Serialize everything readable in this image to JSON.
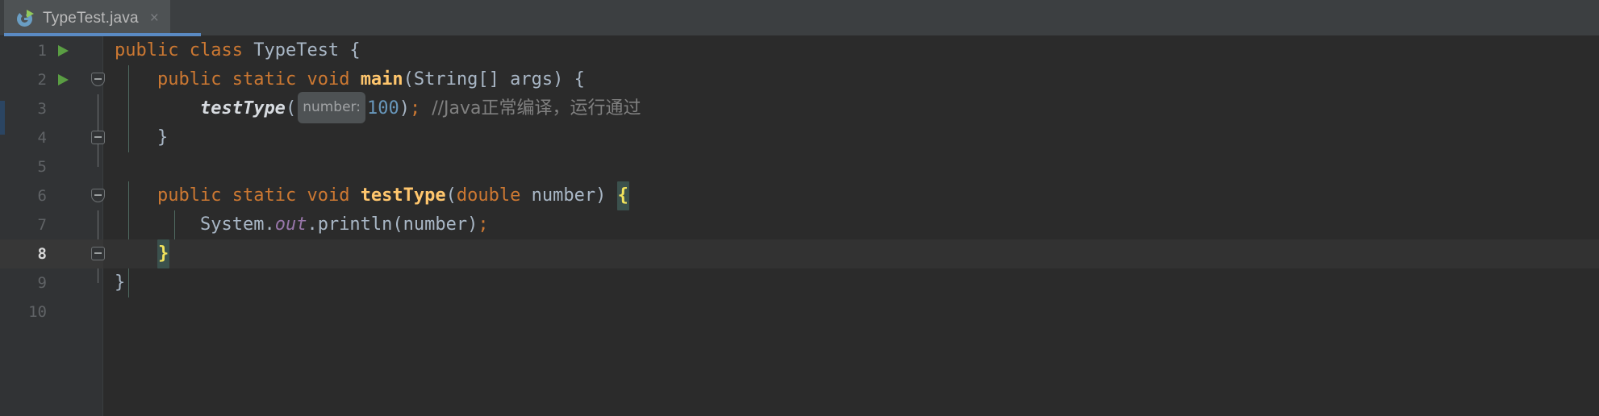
{
  "window": {
    "app": "IntelliJ IDEA Editor",
    "theme": "Darcula"
  },
  "tab": {
    "label": "TypeTest.java",
    "icon": "java-runnable-class-icon",
    "close_label": "×",
    "active": true,
    "accent_color": "#5a8ac3"
  },
  "colors": {
    "editor_background": "#2b2b2b",
    "gutter_background": "#313335",
    "tabbar_background": "#3c3f41",
    "active_tab_background": "#4e5254",
    "keyword": "#cc7832",
    "number": "#6897bb",
    "comment": "#808080",
    "identifier": "#a9b7c6",
    "method_declaration": "#ffc66d",
    "static_field": "#9876aa",
    "brace_highlight_fg": "#f2e35c",
    "brace_highlight_bg": "#3b514d",
    "run_arrow": "#5a9e43",
    "current_line": "#323232",
    "vcs_changed": "#2b4562"
  },
  "gutter": {
    "line_numbers": [
      "1",
      "2",
      "3",
      "4",
      "5",
      "6",
      "7",
      "8",
      "9",
      "10"
    ],
    "current_line_number": "8",
    "run_arrow_lines": [
      "1",
      "2"
    ],
    "fold_marker_lines": [
      "2",
      "4",
      "6",
      "8"
    ]
  },
  "code": {
    "language": "Java",
    "full_text": "public class TypeTest {\n    public static void main(String[] args) {\n        testType(100); //Java正常编译，运行通过\n    }\n\n    public static void testType(double number) {\n        System.out.println(number);\n    }\n}\n",
    "lines": [
      {
        "n": "1",
        "tokens": [
          {
            "t": "public",
            "c": "kw"
          },
          {
            "t": " ",
            "c": "punc"
          },
          {
            "t": "class",
            "c": "kw"
          },
          {
            "t": " ",
            "c": "punc"
          },
          {
            "t": "TypeTest",
            "c": "cls"
          },
          {
            "t": " {",
            "c": "punc"
          }
        ]
      },
      {
        "n": "2",
        "tokens": [
          {
            "t": "    ",
            "c": "punc"
          },
          {
            "t": "public",
            "c": "kw"
          },
          {
            "t": " ",
            "c": "punc"
          },
          {
            "t": "static",
            "c": "kw"
          },
          {
            "t": " ",
            "c": "punc"
          },
          {
            "t": "void",
            "c": "kw"
          },
          {
            "t": " ",
            "c": "punc"
          },
          {
            "t": "main",
            "c": "mdecl"
          },
          {
            "t": "(",
            "c": "punc"
          },
          {
            "t": "String",
            "c": "ident"
          },
          {
            "t": "[] args) {",
            "c": "punc"
          }
        ]
      },
      {
        "n": "3",
        "tokens": [
          {
            "t": "        ",
            "c": "punc"
          },
          {
            "t": "testType",
            "c": "mcall"
          },
          {
            "t": "(",
            "c": "punc"
          },
          {
            "t": "number:",
            "c": "hint"
          },
          {
            "t": "100",
            "c": "num"
          },
          {
            "t": ")",
            "c": "punc"
          },
          {
            "t": ";",
            "c": "semi"
          },
          {
            "t": "  //Java正常编译，运行通过",
            "c": "cmt"
          }
        ]
      },
      {
        "n": "4",
        "tokens": [
          {
            "t": "    }",
            "c": "punc"
          }
        ]
      },
      {
        "n": "5",
        "tokens": []
      },
      {
        "n": "6",
        "tokens": [
          {
            "t": "    ",
            "c": "punc"
          },
          {
            "t": "public",
            "c": "kw"
          },
          {
            "t": " ",
            "c": "punc"
          },
          {
            "t": "static",
            "c": "kw"
          },
          {
            "t": " ",
            "c": "punc"
          },
          {
            "t": "void",
            "c": "kw"
          },
          {
            "t": " ",
            "c": "punc"
          },
          {
            "t": "testType",
            "c": "mdecl"
          },
          {
            "t": "(",
            "c": "punc"
          },
          {
            "t": "double",
            "c": "kw"
          },
          {
            "t": " number) ",
            "c": "punc"
          },
          {
            "t": "{",
            "c": "brace-hl"
          }
        ]
      },
      {
        "n": "7",
        "tokens": [
          {
            "t": "        ",
            "c": "punc"
          },
          {
            "t": "System",
            "c": "ident"
          },
          {
            "t": ".",
            "c": "punc"
          },
          {
            "t": "out",
            "c": "field"
          },
          {
            "t": ".println(number)",
            "c": "ident"
          },
          {
            "t": ";",
            "c": "semi"
          }
        ]
      },
      {
        "n": "8",
        "tokens": [
          {
            "t": "    ",
            "c": "punc"
          },
          {
            "t": "}",
            "c": "brace-hl"
          }
        ]
      },
      {
        "n": "9",
        "tokens": [
          {
            "t": "}",
            "c": "punc"
          }
        ]
      },
      {
        "n": "10",
        "tokens": []
      }
    ]
  }
}
